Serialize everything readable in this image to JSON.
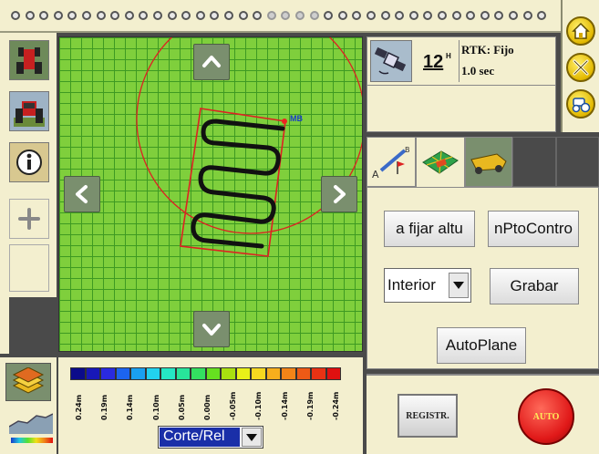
{
  "gps": {
    "satellite_count": "12",
    "satellite_superscript": "H",
    "rtk_status": "RTK: Fijo",
    "update_interval": "1.0 sec"
  },
  "map": {
    "marker_label": "MB"
  },
  "settings": {
    "fix_height_button": "a fijar altu",
    "control_point_button": "nPtoContro",
    "mode_select_value": "Interior",
    "record_button": "Grabar",
    "autoplane_button": "AutoPlane"
  },
  "legend": {
    "colors": [
      "#0b0b8a",
      "#1818b8",
      "#2a2ae0",
      "#1c64f0",
      "#1aa0f0",
      "#22d2ee",
      "#25e6c4",
      "#28e49a",
      "#33e060",
      "#66e020",
      "#a8e010",
      "#e8f018",
      "#f6d820",
      "#f7ae1c",
      "#f38418",
      "#ee5a16",
      "#e83214",
      "#e01010"
    ],
    "labels": [
      "0.24m",
      "0.19m",
      "0.14m",
      "0.10m",
      "0.05m",
      "0.00m",
      "-0.05m",
      "-0.10m",
      "-0.14m",
      "-0.19m",
      "-0.24m"
    ],
    "select_value": "Corte/Rel"
  },
  "bottom": {
    "record_button": "REGISTR.",
    "auto_button": "AUTO"
  }
}
